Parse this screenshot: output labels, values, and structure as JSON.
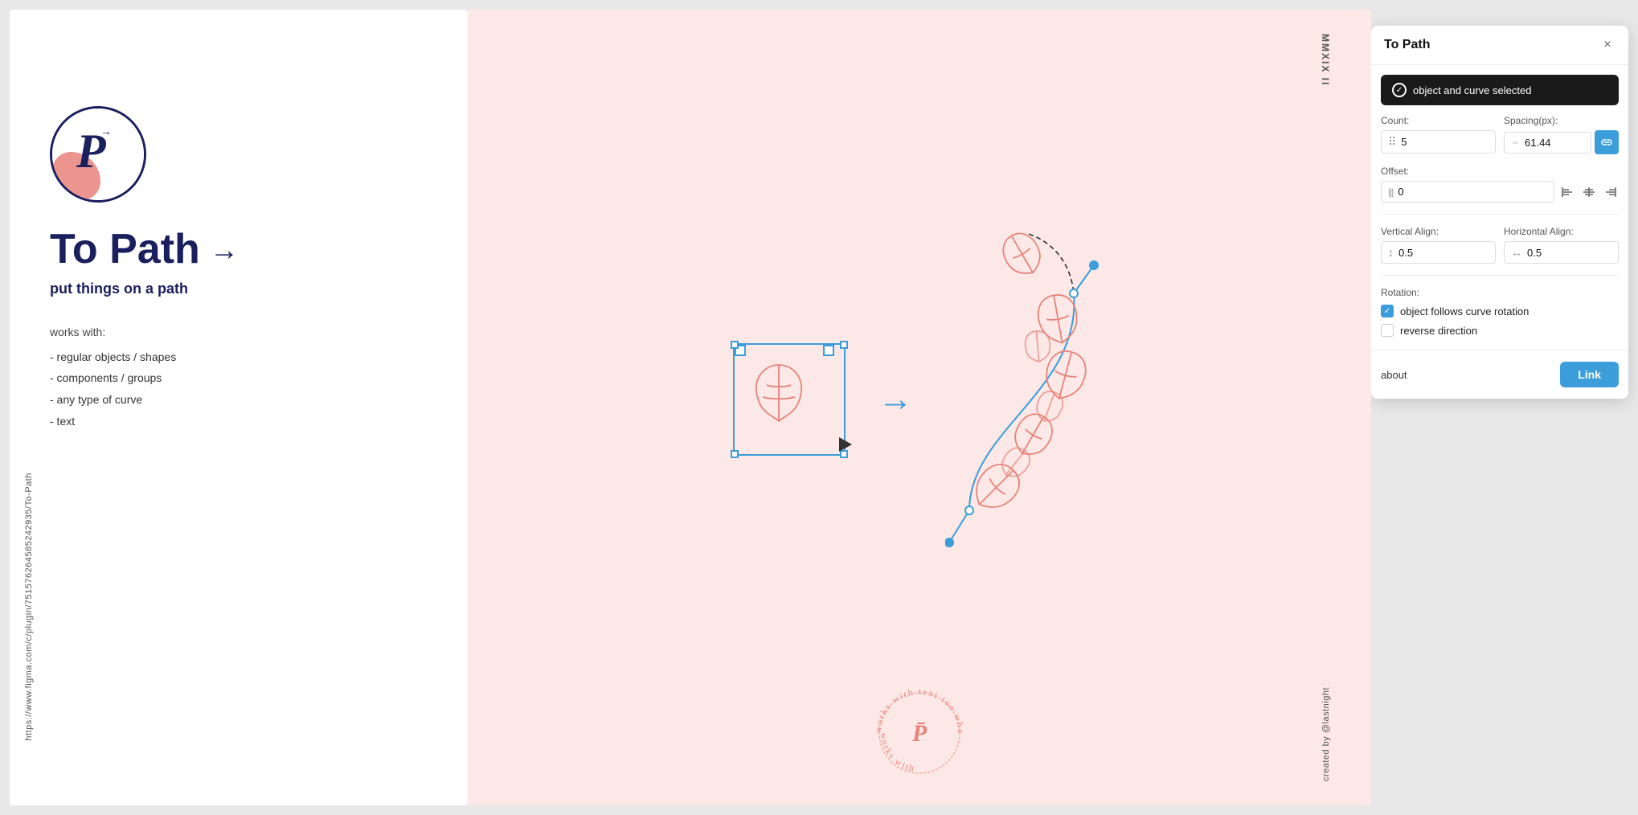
{
  "left_panel": {
    "url_text": "https://www.figma.com/c/plugin/751576264585242935/To-Path",
    "plugin_id": "MMXIX II",
    "logo_letter": "P",
    "title": "To Path",
    "title_arrow": "→",
    "subtitle": "put things on a path",
    "works_with_label": "works with:",
    "works_with_items": [
      "- regular objects / shapes",
      "- components / groups",
      "- any type of curve",
      "- text"
    ]
  },
  "center_panel": {
    "vertical_top": "MMXIX II",
    "vertical_bottom": "created by @lastnight",
    "stamp_text": "works with text too whaat"
  },
  "right_panel": {
    "title": "To Path",
    "close_label": "×",
    "status": {
      "message": "object and curve selected",
      "check": "✓"
    },
    "count": {
      "label": "Count:",
      "value": "5",
      "icon": "⠿"
    },
    "spacing": {
      "label": "Spacing(px):",
      "value": "61.44",
      "icon": "⇔"
    },
    "offset": {
      "label": "Offset:",
      "value": "0",
      "icon": "|||"
    },
    "align_icons": [
      "⊢",
      "⊥",
      "⊣"
    ],
    "vertical_align": {
      "label": "Vertical Align:",
      "value": "0.5",
      "icon": "↕"
    },
    "horizontal_align": {
      "label": "Horizontal Align:",
      "value": "0.5",
      "icon": "↔"
    },
    "rotation": {
      "label": "Rotation:",
      "checkbox1": {
        "checked": true,
        "label": "object follows curve rotation"
      },
      "checkbox2": {
        "checked": false,
        "label": "reverse direction"
      }
    },
    "about_label": "about",
    "link_button_label": "Link"
  }
}
